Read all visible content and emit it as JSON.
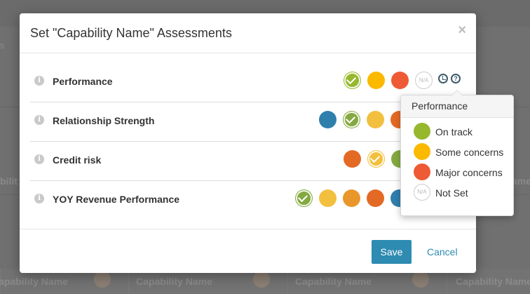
{
  "background": {
    "card_label": "Capability Name",
    "left_fragment": "s",
    "left_fragment_2": "bilit",
    "right_fragment": "ame"
  },
  "modal": {
    "title": "Set \"Capability Name\" Assessments",
    "close_label": "×",
    "rows": [
      {
        "label": "Performance",
        "info": "i"
      },
      {
        "label": "Relationship Strength",
        "info": "i"
      },
      {
        "label": "Credit risk",
        "info": "i"
      },
      {
        "label": "YOY Revenue Performance",
        "info": "i"
      }
    ],
    "na_text": "N/A",
    "help_text": "?",
    "save_label": "Save",
    "cancel_label": "Cancel"
  },
  "popover": {
    "title": "Performance",
    "items": [
      {
        "label": "On track",
        "color": "#97b82d"
      },
      {
        "label": "Some concerns",
        "color": "#fbb900"
      },
      {
        "label": "Major concerns",
        "color": "#ee5a35"
      },
      {
        "label": "Not Set",
        "na_text": "N/A"
      }
    ]
  },
  "colors": {
    "on_track": "#97b82d",
    "some_concerns": "#fbb900",
    "major_concerns": "#ee5a35",
    "blue": "#2f7fad",
    "green": "#84a941",
    "yellow": "#f2bf3e",
    "orange": "#e9972a",
    "dark_orange": "#e36a25",
    "accent": "#2e8bb1"
  }
}
